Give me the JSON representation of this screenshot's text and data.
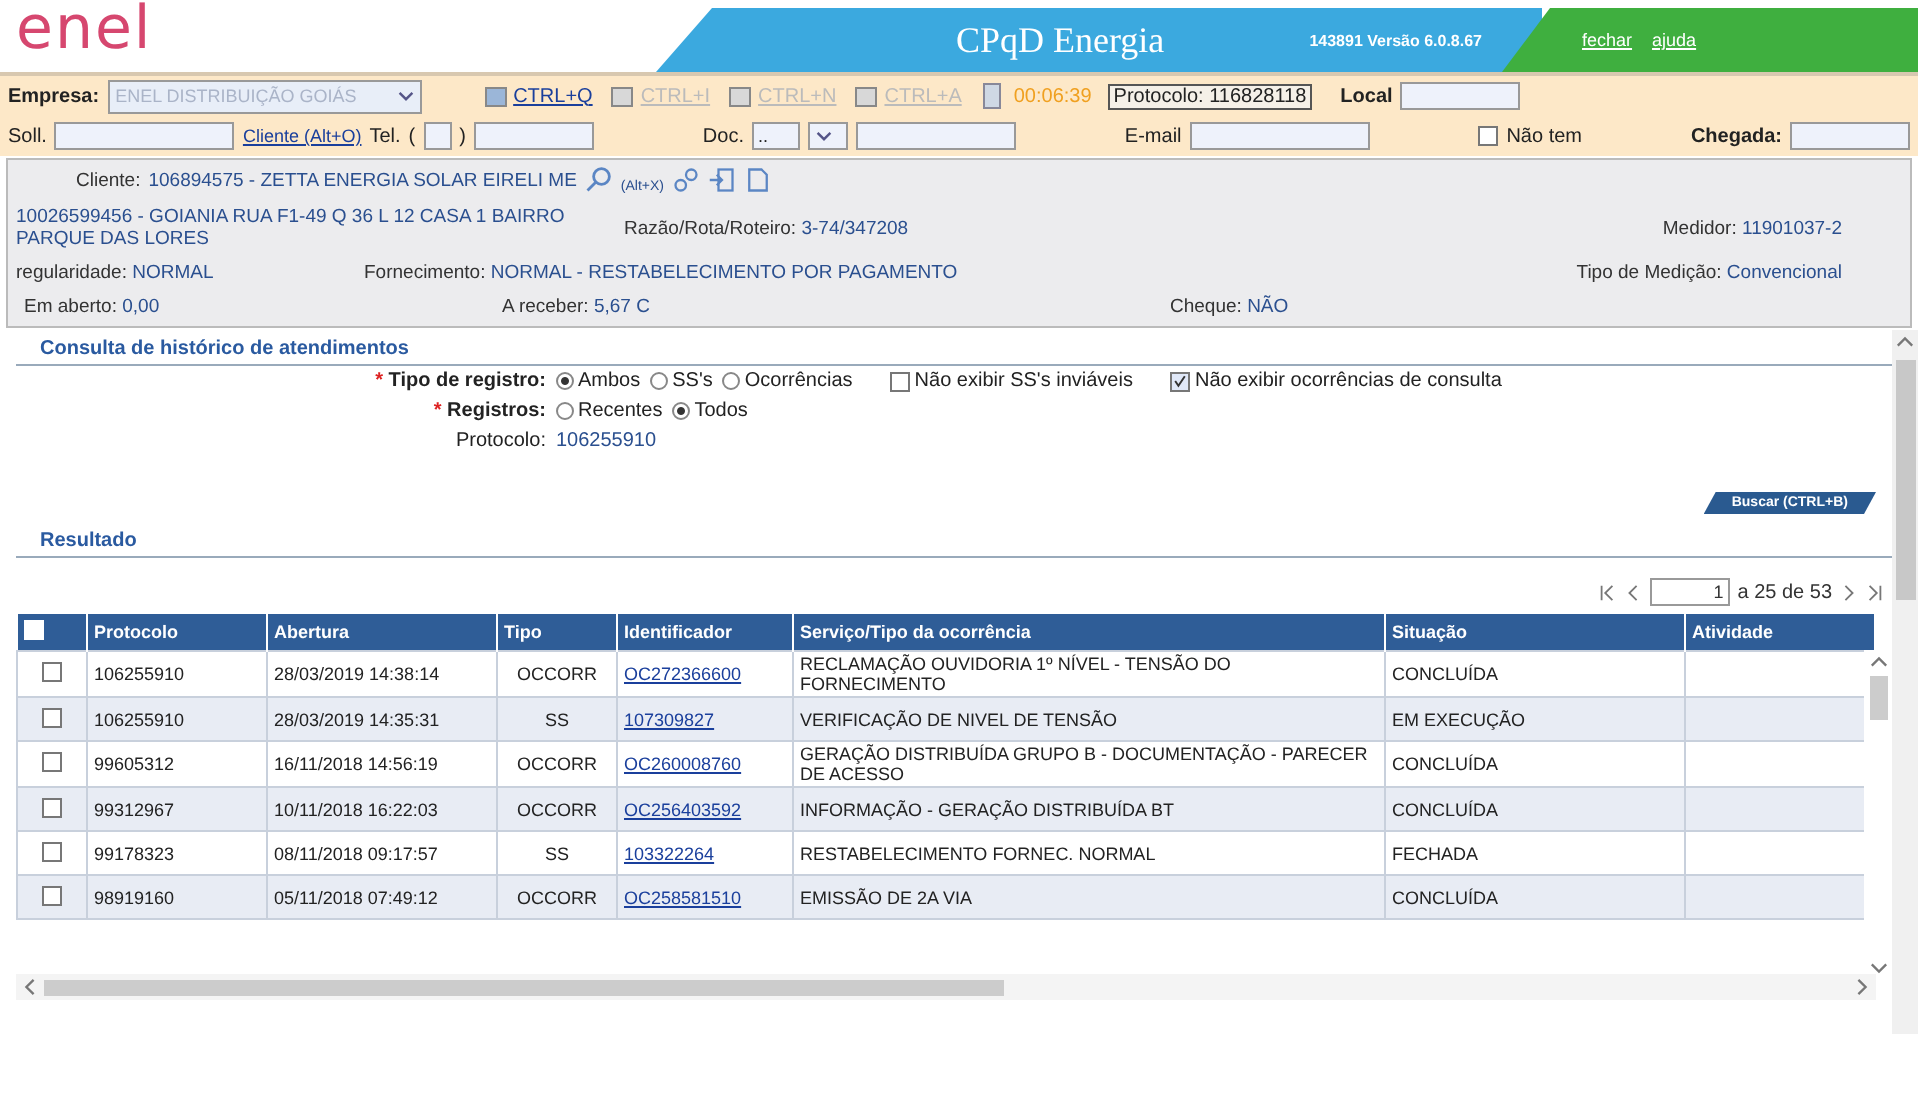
{
  "header": {
    "logo": "enel",
    "title": "CPqD Energia",
    "version": "143891 Versão 6.0.8.67",
    "links": [
      "fechar",
      "ajuda"
    ]
  },
  "toolbar": {
    "empresa_label": "Empresa:",
    "empresa_value": "ENEL DISTRIBUIÇÃO GOIÁS",
    "actions": [
      {
        "label": "CTRL+Q",
        "disabled": false
      },
      {
        "label": "CTRL+I",
        "disabled": true
      },
      {
        "label": "CTRL+N",
        "disabled": true
      },
      {
        "label": "CTRL+A",
        "disabled": true
      }
    ],
    "timer": "00:06:39",
    "protocolo": "Protocolo: 116828118",
    "local_label": "Local"
  },
  "search_row": {
    "soll_label": "Soll.",
    "cliente_link": "Cliente (Alt+O)",
    "tel_label": "Tel.",
    "tel_open": "(",
    "tel_close": ")",
    "doc_label": "Doc.",
    "doc_value": "..",
    "email_label": "E-mail",
    "nao_tem": {
      "label": "Não tem",
      "checked": false
    },
    "chegada_label": "Chegada:"
  },
  "client": {
    "cliente_label": "Cliente:",
    "cliente_value": "106894575 - ZETTA ENERGIA SOLAR EIRELI ME",
    "shortcut": "(Alt+X)",
    "address": "10026599456 - GOIANIA RUA F1-49 Q 36 L 12 CASA 1 BAIRRO PARQUE DAS LORES",
    "razao_label": "Razão/Rota/Roteiro:",
    "razao_value": "3-74/347208",
    "medidor_label": "Medidor:",
    "medidor_value": "11901037-2",
    "regularidade_label": "regularidade:",
    "regularidade_value": "NORMAL",
    "fornecimento_label": "Fornecimento:",
    "fornecimento_value": "NORMAL - RESTABELECIMENTO POR PAGAMENTO",
    "tipo_medicao_label": "Tipo de Medição:",
    "tipo_medicao_value": "Convencional",
    "em_aberto_label": "Em aberto:",
    "em_aberto_value": "0,00",
    "a_receber_label": "A receber:",
    "a_receber_value": "5,67 C",
    "cheque_label": "Cheque:",
    "cheque_value": "NÃO"
  },
  "consulta": {
    "title": "Consulta de histórico de atendimentos",
    "required_mark": "*",
    "tipo_label": "Tipo de registro:",
    "tipo_options": [
      {
        "label": "Ambos",
        "selected": true
      },
      {
        "label": "SS's",
        "selected": false
      },
      {
        "label": "Ocorrências",
        "selected": false
      }
    ],
    "checks": [
      {
        "label": "Não exibir SS's inviáveis",
        "checked": false
      },
      {
        "label": "Não exibir ocorrências de consulta",
        "checked": true
      }
    ],
    "registros_label": "Registros:",
    "registros_options": [
      {
        "label": "Recentes",
        "selected": false
      },
      {
        "label": "Todos",
        "selected": true
      }
    ],
    "protocolo_label": "Protocolo:",
    "protocolo_value": "106255910",
    "buscar": "Buscar (CTRL+B)"
  },
  "resultado": {
    "title": "Resultado",
    "page": "1",
    "page_info": "a 25 de 53",
    "columns": [
      "Protocolo",
      "Abertura",
      "Tipo",
      "Identificador",
      "Serviço/Tipo da ocorrência",
      "Situação",
      "Atividade"
    ],
    "header_checked": false,
    "rows": [
      {
        "checked": false,
        "protocolo": "106255910",
        "abertura": "28/03/2019 14:38:14",
        "tipo": "OCCORR",
        "identificador": "OC272366600",
        "servico": "RECLAMAÇÃO OUVIDORIA 1º NÍVEL - TENSÃO DO FORNECIMENTO",
        "situacao": "CONCLUÍDA"
      },
      {
        "checked": false,
        "protocolo": "106255910",
        "abertura": "28/03/2019 14:35:31",
        "tipo": "SS",
        "identificador": "107309827",
        "servico": "VERIFICAÇÃO DE NIVEL DE TENSÃO",
        "situacao": "EM EXECUÇÃO"
      },
      {
        "checked": false,
        "protocolo": "99605312",
        "abertura": "16/11/2018 14:56:19",
        "tipo": "OCCORR",
        "identificador": "OC260008760",
        "servico": "GERAÇÃO DISTRIBUÍDA GRUPO B - DOCUMENTAÇÃO - PARECER DE ACESSO",
        "situacao": "CONCLUÍDA"
      },
      {
        "checked": false,
        "protocolo": "99312967",
        "abertura": "10/11/2018 16:22:03",
        "tipo": "OCCORR",
        "identificador": "OC256403592",
        "servico": "INFORMAÇÃO - GERAÇÃO DISTRIBUÍDA BT",
        "situacao": "CONCLUÍDA"
      },
      {
        "checked": false,
        "protocolo": "99178323",
        "abertura": "08/11/2018 09:17:57",
        "tipo": "SS",
        "identificador": "103322264",
        "servico": "RESTABELECIMENTO FORNEC. NORMAL",
        "situacao": "FECHADA"
      },
      {
        "checked": false,
        "protocolo": "98919160",
        "abertura": "05/11/2018 07:49:12",
        "tipo": "OCCORR",
        "identificador": "OC258581510",
        "servico": "EMISSÃO DE 2A VIA",
        "situacao": "CONCLUÍDA"
      }
    ]
  }
}
